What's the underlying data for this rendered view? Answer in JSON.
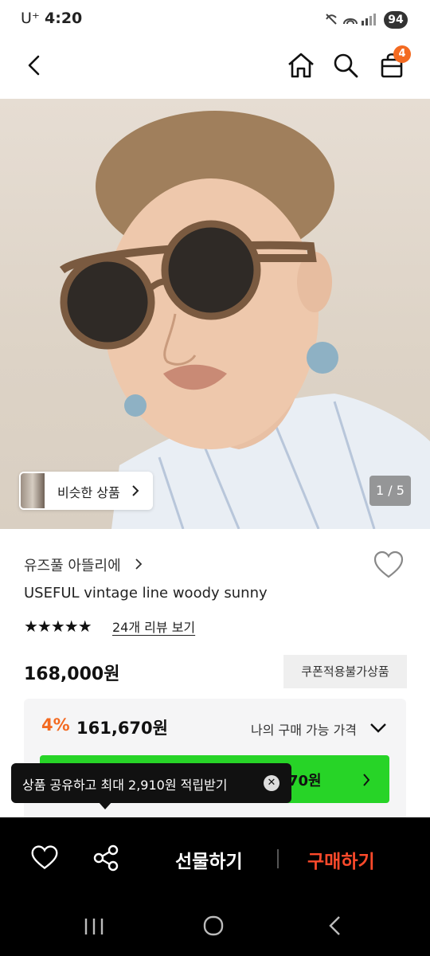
{
  "status_bar": {
    "carrier": "U⁺",
    "time": "4:20",
    "battery": "94"
  },
  "nav": {
    "cart_count": "4"
  },
  "hero": {
    "similar_label": "비슷한 상품",
    "counter": "1 / 5"
  },
  "product": {
    "brand": "유즈풀 아뜰리에",
    "name": "USEFUL vintage line woody sunny",
    "stars": "★★★★★",
    "review_link": "24개 리뷰 보기",
    "price": "168,000원",
    "coupon_badge": "쿠폰적용불가상품"
  },
  "price_box": {
    "discount": "4%",
    "discount_price": "161,670원",
    "my_price_label": "나의 구매 가능 가격",
    "green_text": "70원"
  },
  "tooltip": {
    "text": "상품 공유하고 최대 2,910원 적립받기"
  },
  "action_bar": {
    "gift": "선물하기",
    "buy": "구매하기"
  },
  "colors": {
    "accent": "#f36a21",
    "buy": "#ff4a2b",
    "green": "#27d427"
  }
}
